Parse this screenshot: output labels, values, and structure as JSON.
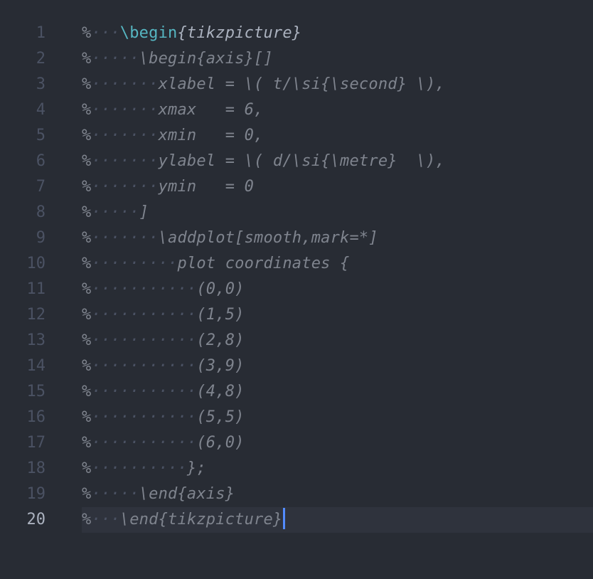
{
  "editor": {
    "lines": [
      {
        "number": "1",
        "dots": "···",
        "code": "\\begin",
        "extra": "{tikzpicture}",
        "kind": "begin"
      },
      {
        "number": "2",
        "dots": "·····",
        "code": "\\begin{axis}[]"
      },
      {
        "number": "3",
        "dots": "·······",
        "code": "xlabel = \\( t/\\si{\\second} \\),"
      },
      {
        "number": "4",
        "dots": "·······",
        "code": "xmax   = 6,"
      },
      {
        "number": "5",
        "dots": "·······",
        "code": "xmin   = 0,"
      },
      {
        "number": "6",
        "dots": "·······",
        "code": "ylabel = \\( d/\\si{\\metre}  \\),"
      },
      {
        "number": "7",
        "dots": "·······",
        "code": "ymin   = 0"
      },
      {
        "number": "8",
        "dots": "·····",
        "code": "]"
      },
      {
        "number": "9",
        "dots": "·······",
        "code": "\\addplot[smooth,mark=*]"
      },
      {
        "number": "10",
        "dots": "·········",
        "code": "plot coordinates {"
      },
      {
        "number": "11",
        "dots": "···········",
        "code": "(0,0)"
      },
      {
        "number": "12",
        "dots": "···········",
        "code": "(1,5)"
      },
      {
        "number": "13",
        "dots": "···········",
        "code": "(2,8)"
      },
      {
        "number": "14",
        "dots": "···········",
        "code": "(3,9)"
      },
      {
        "number": "15",
        "dots": "···········",
        "code": "(4,8)"
      },
      {
        "number": "16",
        "dots": "···········",
        "code": "(5,5)"
      },
      {
        "number": "17",
        "dots": "···········",
        "code": "(6,0)"
      },
      {
        "number": "18",
        "dots": "··········",
        "code": "};"
      },
      {
        "number": "19",
        "dots": "·····",
        "code": "\\end{axis}"
      },
      {
        "number": "20",
        "dots": "···",
        "code": "\\end{tikzpicture}"
      }
    ],
    "comment_char": "%",
    "active_line": 20,
    "colors": {
      "background": "#282c34",
      "current_line": "#2f333d",
      "keyword": "#56b6c2",
      "comment": "#7f848e",
      "cursor": "#528bff"
    }
  }
}
